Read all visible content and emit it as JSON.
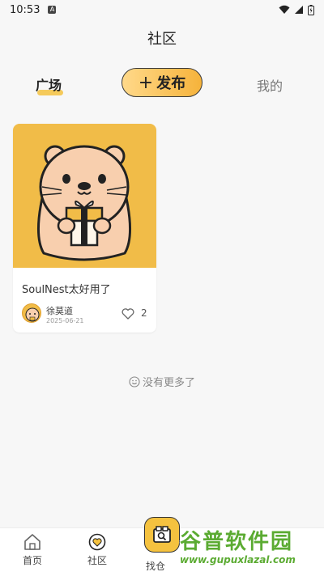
{
  "status_bar": {
    "time": "10:53",
    "notification_letter": "A"
  },
  "header": {
    "title": "社区"
  },
  "tabs": {
    "square": "广场",
    "publish_plus": "+",
    "publish": "发布",
    "mine": "我的"
  },
  "feed": [
    {
      "title": "SoulNest太好用了",
      "author": "徐莫道",
      "date": "2025-06-21",
      "likes": "2"
    }
  ],
  "footer": {
    "no_more": "没有更多了"
  },
  "bottom_nav": {
    "home": "首页",
    "community": "社区",
    "find_warehouse": "找仓"
  },
  "watermark": {
    "title": "谷普软件园",
    "url": "www.gupuxlazal.com"
  },
  "colors": {
    "accent": "#f5c23f",
    "thumb_bg": "#f1bc48",
    "watermark": "#5bab32"
  }
}
